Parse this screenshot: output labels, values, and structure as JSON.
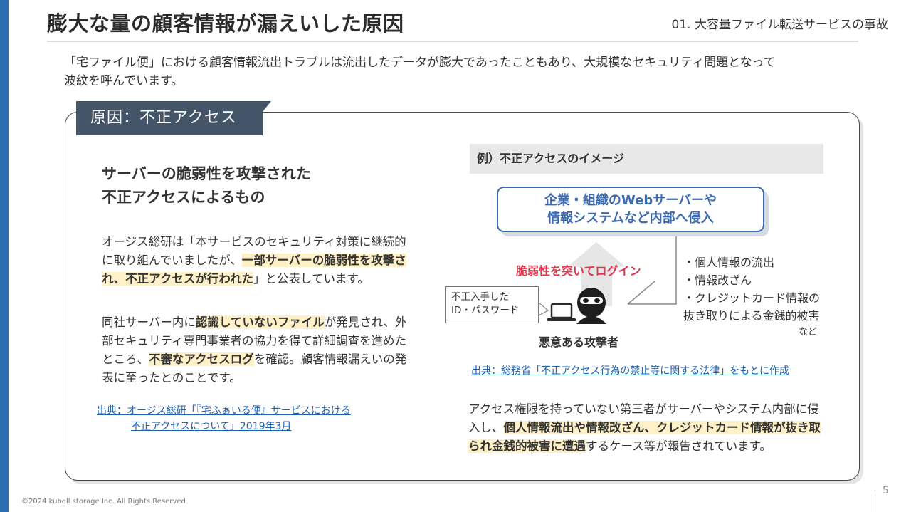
{
  "slide": {
    "title": "膨大な量の顧客情報が漏えいした原因",
    "section": "01. 大容量ファイル転送サービスの事故",
    "lead": [
      "「宅ファイル便」における顧客情報流出トラブルは流出したデータが膨大であったこともあり、大規模なセキュリティ問題となって",
      "波紋を呼んでいます。"
    ],
    "page_number": "5",
    "copyright": "©2024 kubell storage Inc. All Rights Reserved"
  },
  "card": {
    "tab_label": "原因：不正アクセス",
    "left": {
      "heading": [
        "サーバーの脆弱性を攻撃された",
        "不正アクセスによるもの"
      ],
      "para1": {
        "t1": "オージス総研は「本サービスのセキュリティ対策に継続的に取り組んでいましたが、",
        "h1": "一部サーバーの脆弱性を攻撃され、不正アクセスが行われた",
        "t2": "」と公表しています。"
      },
      "para2": {
        "t1": "同社サーバー内に",
        "h1": "認識していないファイル",
        "t2": "が発見され、外部セキュリティ専門事業者の協力を得て詳細調査を進めたところ、",
        "h2": "不審なアクセスログ",
        "t3": "を確認。顧客情報漏えいの発表に至ったとのことです。"
      },
      "source": [
        "出典：オージス総研「『宅ふぁいる便』サービスにおける",
        "不正アクセスについて」2019年3月"
      ]
    },
    "right": {
      "example_heading": "例）不正アクセスのイメージ",
      "target": [
        "企業・組織のWebサーバーや",
        "情報システムなど内部へ侵入"
      ],
      "exploit_label": "脆弱性を突いてログイン",
      "credentials": [
        "不正入手した",
        "ID・パスワード"
      ],
      "attacker": "悪意ある攻撃者",
      "effects": [
        "・個人情報の流出",
        "・情報改ざん",
        "・クレジットカード情報の",
        "抜き取りによる金銭的被害"
      ],
      "effects_etc": "など",
      "source": "出典：総務省「不正アクセス行為の禁止等に関する法律」をもとに作成",
      "para3": {
        "t1": "アクセス権限を持っていない第三者がサーバーやシステム内部に侵入し、",
        "h1": "個人情報流出や情報改ざん、クレジットカード情報が抜き取られ金銭的被害に遭遇",
        "t2": "するケース等が報告されています。"
      }
    }
  },
  "colors": {
    "accent_blue": "#2c6db4",
    "tab_bg": "#445469",
    "highlight": "#fff1c7",
    "alert_red": "#e0364b",
    "link_blue": "#1f5fae"
  }
}
